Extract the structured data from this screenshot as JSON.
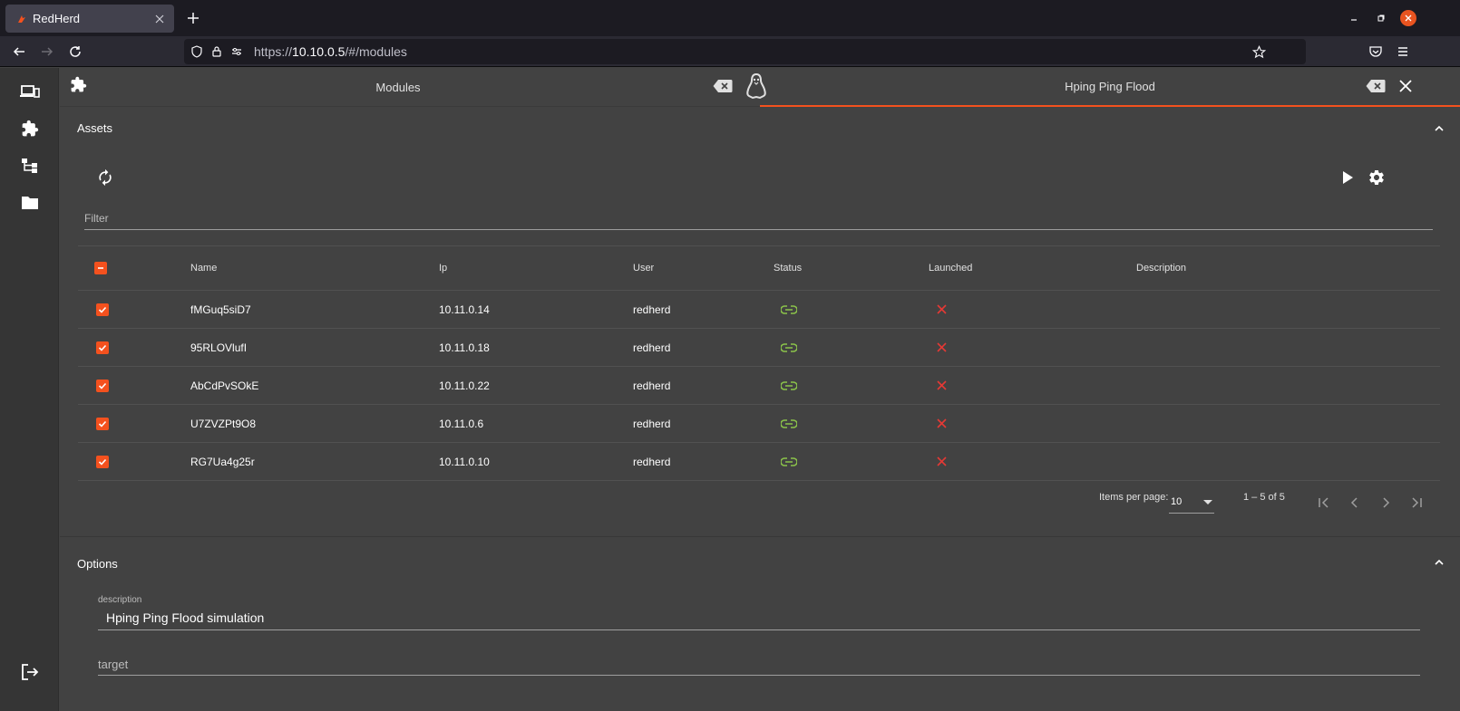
{
  "browser": {
    "tab_title": "RedHerd",
    "url_prefix": "https://",
    "url_host": "10.10.0.5",
    "url_path": "/#/modules"
  },
  "app_tabs": {
    "modules_label": "Modules",
    "active_label": "Hping Ping Flood"
  },
  "assets": {
    "title": "Assets",
    "filter_placeholder": "Filter",
    "columns": {
      "name": "Name",
      "ip": "Ip",
      "user": "User",
      "status": "Status",
      "launched": "Launched",
      "description": "Description"
    },
    "rows": [
      {
        "name": "fMGuq5siD7",
        "ip": "10.11.0.14",
        "user": "redherd",
        "status": "link-icon",
        "launched": "x-icon",
        "selected": true
      },
      {
        "name": "95RLOVlufI",
        "ip": "10.11.0.18",
        "user": "redherd",
        "status": "link-icon",
        "launched": "x-icon",
        "selected": true
      },
      {
        "name": "AbCdPvSOkE",
        "ip": "10.11.0.22",
        "user": "redherd",
        "status": "link-icon",
        "launched": "x-icon",
        "selected": true
      },
      {
        "name": "U7ZVZPt9O8",
        "ip": "10.11.0.6",
        "user": "redherd",
        "status": "link-icon",
        "launched": "x-icon",
        "selected": true
      },
      {
        "name": "RG7Ua4g25r",
        "ip": "10.11.0.10",
        "user": "redherd",
        "status": "link-icon",
        "launched": "x-icon",
        "selected": true
      }
    ],
    "paginator": {
      "items_per_page_label": "Items per page:",
      "items_per_page_value": "10",
      "range_label": "1 – 5 of 5"
    }
  },
  "options": {
    "title": "Options",
    "description_label": "description",
    "description_value": "Hping Ping Flood simulation",
    "target_placeholder": "target"
  },
  "colors": {
    "accent": "#f4511e",
    "status_ok": "#8bc34a",
    "launched_no": "#e53935"
  }
}
